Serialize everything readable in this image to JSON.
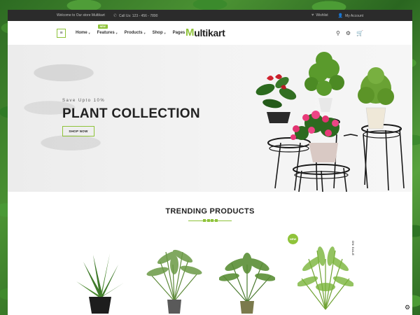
{
  "topbar": {
    "welcome": "Welcome to Our store Multikart",
    "call": "Call Us: 123 - 456 - 7890",
    "wishlist": "Wishlist",
    "account": "My Account"
  },
  "nav": {
    "items": [
      {
        "label": "Home"
      },
      {
        "label": "Features",
        "badge": "NEW"
      },
      {
        "label": "Products"
      },
      {
        "label": "Shop"
      },
      {
        "label": "Pages"
      }
    ]
  },
  "logo": {
    "first": "M",
    "rest": "ultikart"
  },
  "hero": {
    "subtitle": "Save Upto 10%",
    "title": "PLANT COLLECTION",
    "button": "SHOP NOW"
  },
  "trending": {
    "title": "TRENDING PRODUCTS",
    "new_badge": "NEW",
    "sale_tag": "ON SALE"
  },
  "colors": {
    "accent": "#8fc33a",
    "topbar": "#2b2b2b"
  },
  "icons": [
    "menu-icon",
    "phone-icon",
    "heart-icon",
    "user-icon",
    "search-icon",
    "settings-icon",
    "cart-icon"
  ]
}
